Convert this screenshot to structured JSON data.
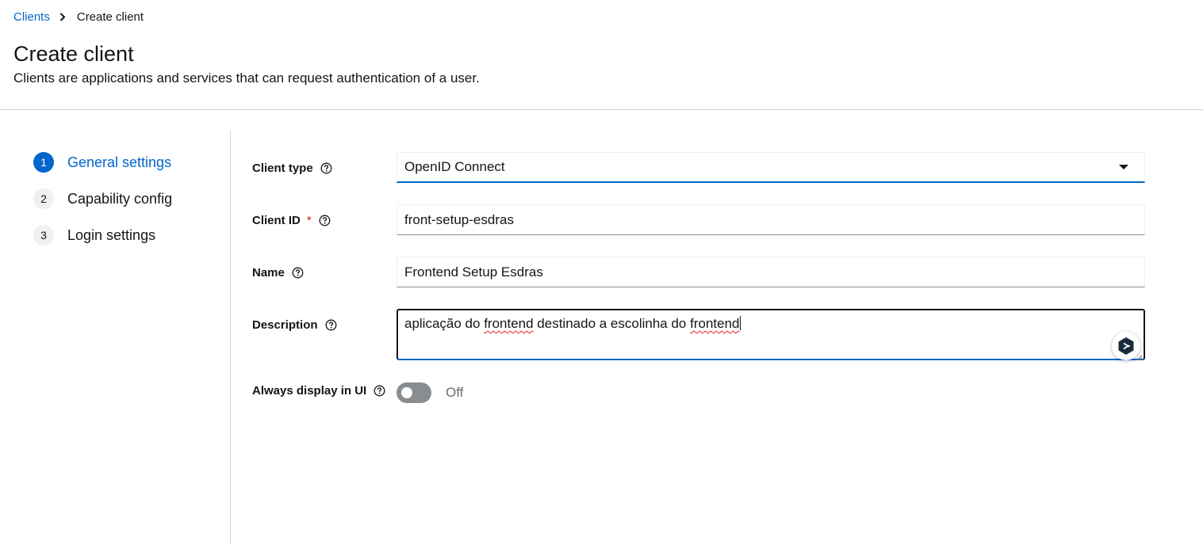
{
  "breadcrumb": {
    "parent": "Clients",
    "current": "Create client"
  },
  "header": {
    "title": "Create client",
    "subtitle": "Clients are applications and services that can request authentication of a user."
  },
  "wizard": {
    "steps": [
      {
        "number": "1",
        "label": "General settings",
        "active": true
      },
      {
        "number": "2",
        "label": "Capability config",
        "active": false
      },
      {
        "number": "3",
        "label": "Login settings",
        "active": false
      }
    ]
  },
  "form": {
    "client_type": {
      "label": "Client type",
      "value": "OpenID Connect"
    },
    "client_id": {
      "label": "Client ID",
      "required_mark": "*",
      "value": "front-setup-esdras"
    },
    "name": {
      "label": "Name",
      "value": "Frontend Setup Esdras"
    },
    "description": {
      "label": "Description",
      "value_parts": [
        "aplicação do ",
        "frontend",
        " destinado a escolinha do ",
        "frontend"
      ]
    },
    "always_display": {
      "label": "Always display in UI",
      "state_text": "Off",
      "enabled": false
    }
  },
  "icons": {
    "breadcrumb_separator": "chevron-right-icon",
    "help": "help-circle-icon",
    "dropdown": "caret-down-icon",
    "extension": "grammar-extension-icon"
  },
  "colors": {
    "accent": "#0066cc",
    "required": "#c9190b",
    "toggle_off": "#8a8d90"
  }
}
